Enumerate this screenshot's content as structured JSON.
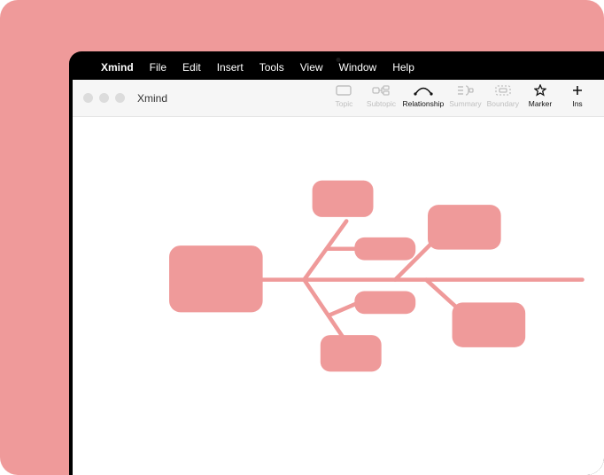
{
  "menubar": {
    "app": "Xmind",
    "items": [
      "File",
      "Edit",
      "Insert",
      "Tools",
      "View",
      "Window",
      "Help"
    ]
  },
  "window": {
    "title": "Xmind"
  },
  "toolbar": {
    "topic": "Topic",
    "subtopic": "Subtopic",
    "relationship": "Relationship",
    "summary": "Summary",
    "boundary": "Boundary",
    "marker": "Marker",
    "insert": "Ins"
  },
  "colors": {
    "node": "#ef9a9a",
    "stroke": "#ef9a9a"
  }
}
